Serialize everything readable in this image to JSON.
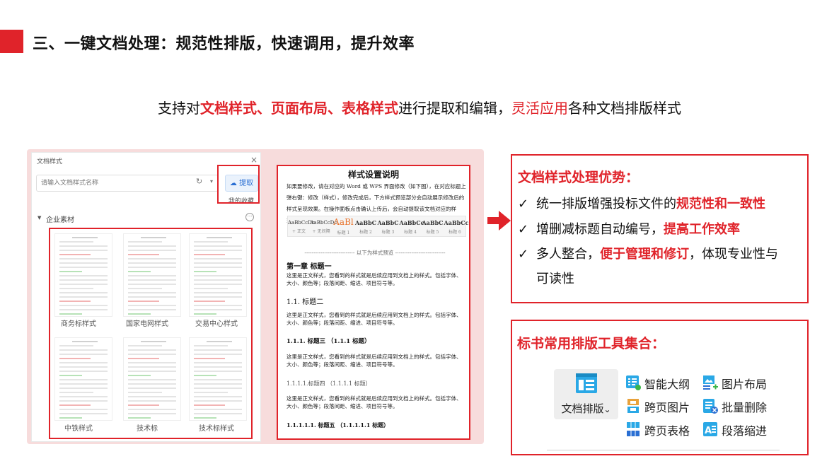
{
  "header": {
    "title": "三、一键文档处理：规范性排版，快速调用，提升效率"
  },
  "subtitle": {
    "p1": "支持对",
    "p2": "文档样式、页面布局、表格样式",
    "p3": "进行提取和编辑，",
    "p4": "灵活应用",
    "p5": "各种文档排版样式"
  },
  "style_dialog": {
    "title": "文档样式",
    "close": "×",
    "search_placeholder": "请输入文档样式名称",
    "refresh": "↻",
    "dropdown": "▾",
    "extract": "提取",
    "favorites": "我的收藏",
    "group_toggle": "▼",
    "group": "企业素材",
    "more": "···",
    "templates": [
      "商务标样式",
      "国家电网样式",
      "交易中心样式",
      "中铁样式",
      "技术标",
      "技术标样式"
    ]
  },
  "doc_preview": {
    "title": "样式设置说明",
    "intro": "如果要修改，请在对应的 Word 或 WPS 界面修改（如下图），在对应标题上弹右键：修改（样式），修改完成后，下方样式预览部分会自动展示修改后的样式呈现效果。在操作面板点击确认上传后，会自动提取该文档对应的样式。",
    "ribbon": [
      {
        "sample": "AaBbCcDc",
        "name": "+ 正文"
      },
      {
        "sample": "AaBbCcDc",
        "name": "+ 无间隔"
      },
      {
        "sample": "AaBl",
        "name": "标题 1"
      },
      {
        "sample": "AaBbC",
        "name": "标题 2"
      },
      {
        "sample": "AaBbC",
        "name": "标题 3"
      },
      {
        "sample": "AaBbCc",
        "name": "标题 4"
      },
      {
        "sample": "AaBbC",
        "name": "标题 5"
      },
      {
        "sample": "AaBbCcI",
        "name": "标题 6"
      }
    ],
    "separator": "---------------------------- 以下为样式预览 ----------------------------",
    "h1": "第一章  标题一",
    "h2": "1.1. 标题二",
    "h3": "1.1.1.  标题三  （1.1.1 标题）",
    "h4": "1.1.1.1.标题四  （1.1.1.1 标题）",
    "h5": "1.1.1.1.1.  标题五  （1.1.1.1.1 标题）",
    "body": "这里是正文样式，您看到的样式就是后续应用到文档上的样式。包括字体、大小、颜色等；段落间距、缩进、项目符号等。"
  },
  "advantages": {
    "title": "文档样式处理优势：",
    "check": "✓",
    "items": [
      {
        "pre": "统一排版增强投标文件的",
        "em": "规范性和一致性",
        "post": ""
      },
      {
        "pre": "增删减标题自动编号，",
        "em": "提高工作效率",
        "post": ""
      },
      {
        "pre": "多人整合，",
        "em": "便于管理和修订",
        "post": "，体现专业性与"
      }
    ],
    "item3_line2": "可读性"
  },
  "tools": {
    "title": "标书常用排版工具集合：",
    "main_label": "文档排版",
    "main_caret": "⌄",
    "items": [
      "智能大纲",
      "图片布局",
      "跨页图片",
      "批量删除",
      "跨页表格",
      "段落缩进"
    ]
  },
  "colors": {
    "accent": "#e0232a",
    "blue": "#2a6fd3",
    "cyan": "#2aa8e6",
    "green": "#3bb54a"
  }
}
